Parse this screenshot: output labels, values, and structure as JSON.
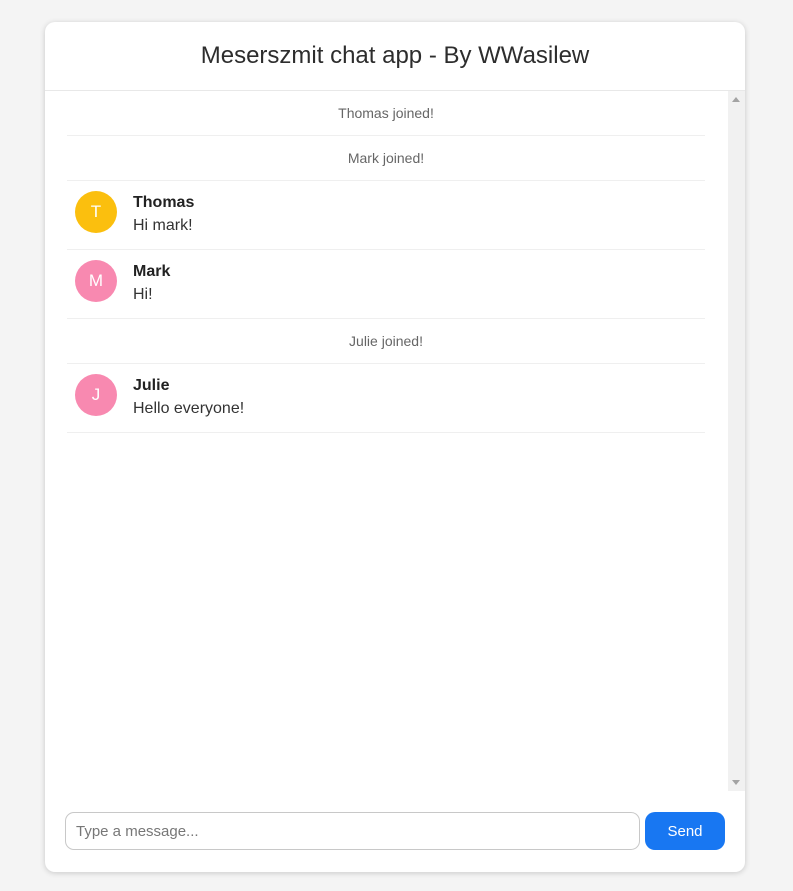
{
  "app": {
    "title": "Meserszmit chat app - By WWasilew"
  },
  "messages": [
    {
      "kind": "system",
      "text": "Thomas joined!"
    },
    {
      "kind": "system",
      "text": "Mark joined!"
    },
    {
      "kind": "chat",
      "name": "Thomas",
      "initial": "T",
      "text": "Hi mark!",
      "avatar_color": "#fbbf0e"
    },
    {
      "kind": "chat",
      "name": "Mark",
      "initial": "M",
      "text": "Hi!",
      "avatar_color": "#f889b0"
    },
    {
      "kind": "system",
      "text": "Julie joined!"
    },
    {
      "kind": "chat",
      "name": "Julie",
      "initial": "J",
      "text": "Hello everyone!",
      "avatar_color": "#f889b0"
    }
  ],
  "composer": {
    "placeholder": "Type a message...",
    "value": "",
    "send_label": "Send"
  },
  "colors": {
    "accent": "#1877f2",
    "background": "#f4f4f4"
  }
}
